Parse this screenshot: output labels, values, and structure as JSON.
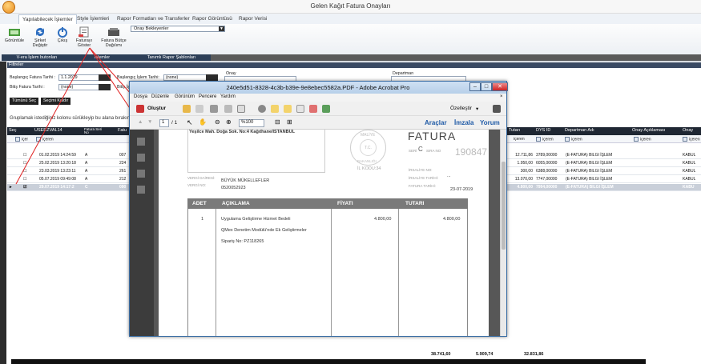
{
  "app": {
    "title": "Gelen Kağıt Fatura Onayları"
  },
  "ribbon": {
    "tabs": [
      "Yapılabilecek İşlemler",
      "Style İşlemleri",
      "Rapor Formatları ve Transferler",
      "Rapor Görüntüsü",
      "Rapor Verisi"
    ],
    "buttons": [
      {
        "label": "Görüntüle",
        "icon": "view-icon"
      },
      {
        "label": "Şirket Değiştir",
        "icon": "switch-company-icon"
      },
      {
        "label": "Çıkış",
        "icon": "power-icon"
      },
      {
        "label": "Faturayı Göster",
        "icon": "invoice-icon"
      },
      {
        "label": "Fatura Bütçe Dağılımı",
        "icon": "budget-icon"
      }
    ],
    "select_value": "Onay Bekleyenler",
    "groups": [
      "V-era İşlem butonları",
      "İşlemler",
      "Tanımlı Rapor Şablonları"
    ]
  },
  "filter": {
    "title": "Filtreler",
    "start_date_label": "Başlangıç Fatura Tarihi :",
    "start_date_value": "1.1.2019",
    "end_date_label": "Bitiş Fatura Tarihi :",
    "end_date_value": "(none)",
    "start_op_label": "Başlangıç İşlem Tarihi:",
    "start_op_value": "(none)",
    "end_op_label": "Bitiş İş",
    "onay_label": "Onay",
    "departman_label": "Departman",
    "select_all": "Tümünü Seç",
    "clear_selection": "Seçimi Kaldır"
  },
  "group_hint": "Gruplamak istediğiniz kolonu sürükleyip bu alana bırakın",
  "grid": {
    "headers": [
      "Seç",
      "USERZVAL14",
      "Fatura Seri No",
      "Fatu",
      "Tutarı",
      "DYS ID",
      "Departman Adı",
      "Onay Açıklaması",
      "Onay"
    ],
    "filter_labels": [
      "içer",
      "içeren",
      "içeren",
      "içeren",
      "içeren",
      "içeren",
      "içeren",
      "içeren"
    ],
    "rows": [
      {
        "date": "01.02.2019 14:24:59",
        "seri": "A",
        "no": "007",
        "tutar": "12.711,86",
        "dys": "3789,00000",
        "dept": "(E-FATURA) BILGI İŞLEM",
        "onay": "KABUL"
      },
      {
        "date": "25.02.2019 13:20:18",
        "seri": "A",
        "no": "224",
        "tutar": "1.950,00",
        "dys": "6055,00000",
        "dept": "(E-FATURA) BILGI İŞLEM",
        "onay": "KABUL"
      },
      {
        "date": "23.03.2019 13:23:11",
        "seri": "A",
        "no": "261",
        "tutar": "300,00",
        "dys": "6388,00000",
        "dept": "(E-FATURA) BILGI İŞLEM",
        "onay": "KABUL"
      },
      {
        "date": "05.07.2019 09:49:08",
        "seri": "A",
        "no": "212",
        "tutar": "13.070,00",
        "dys": "7747,00000",
        "dept": "(E-FATURA) BILGI İŞLEM",
        "onay": "KABUL"
      },
      {
        "date": "29.07.2019 14:17:2",
        "seri": "C",
        "no": "090",
        "tutar": "4.800,00",
        "dys": "7994,00000",
        "dept": "(E-FATURA) BILGI İŞLEM",
        "onay": "KABU"
      }
    ],
    "totals": [
      "38.741,60",
      "5.909,74",
      "32.831,86"
    ]
  },
  "acrobat": {
    "title": "240e5d51-8328-4c3b-b39e-9e8ebec5582a.PDF - Adobe Acrobat Pro",
    "menu": [
      "Dosya",
      "Düzenle",
      "Görünüm",
      "Pencere",
      "Yardım"
    ],
    "create_label": "Oluştur",
    "customize_label": "Özelleştir",
    "page_current": "1",
    "page_total": "/ 1",
    "zoom": "%100",
    "links": [
      "Araçlar",
      "İmzala",
      "Yorum"
    ]
  },
  "invoice": {
    "address": "Yeşilce Mah. Doğa Sok. No:4 Kağıthane/İSTANBUL",
    "title": "FATURA",
    "seri_label": "SERİ",
    "seri_value": "C",
    "sira_label": "SIRA NO",
    "number": "190847",
    "stamp_line1": "MALİYE",
    "stamp_line2": "T.C.",
    "stamp_line3": "BAKANLIĞI",
    "stamp_code": "İL KODU:34",
    "irsaliye_no_label": "İRSALİYE NO:",
    "irsaliye_tarih_label": "İRSALİYE TARİHİ:",
    "irsaliye_tarih_value": "...",
    "fatura_tarih_label": "FATURA TARİHİ:",
    "fatura_tarih_value": "23-07-2019",
    "vergi_dairesi_label": "VERGİ DAİRESİ:",
    "vergi_dairesi_value": "BÜYÜK MÜKELLEFLER",
    "vergi_no_label": "VERGİ NO:",
    "vergi_no_value": "0520052923",
    "headers": [
      "ADET",
      "AÇIKLAMA",
      "FİYATI",
      "TUTARI"
    ],
    "qty": "1",
    "line1": "Uygulama Geliştirme Hizmet Bedeli",
    "line2": "QMex Denetim Modülü'nde Ek Geliştirmeler",
    "line3": "Sipariş No: PZ118265",
    "price": "4.800,00",
    "total": "4.800,00"
  }
}
